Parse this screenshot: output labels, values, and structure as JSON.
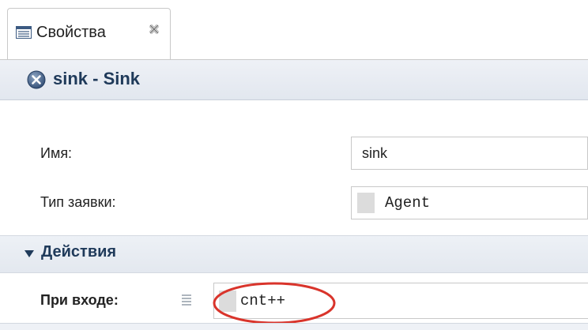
{
  "tab": {
    "label": "Свойства",
    "icon": "properties-icon",
    "close_icon": "close-icon"
  },
  "header": {
    "title": "sink - Sink",
    "icon": "sink-block-icon"
  },
  "fields": {
    "name_label": "Имя:",
    "name_value": "sink",
    "agent_type_label": "Тип заявки:",
    "agent_type_value": "Agent"
  },
  "actions_section": {
    "title": "Действия",
    "expanded": true,
    "on_enter_label": "При входе:",
    "on_enter_value": "cnt++",
    "code_icon": "code-lines-icon"
  },
  "colors": {
    "header_text": "#1f3a5a",
    "highlight": "#d9342b"
  }
}
